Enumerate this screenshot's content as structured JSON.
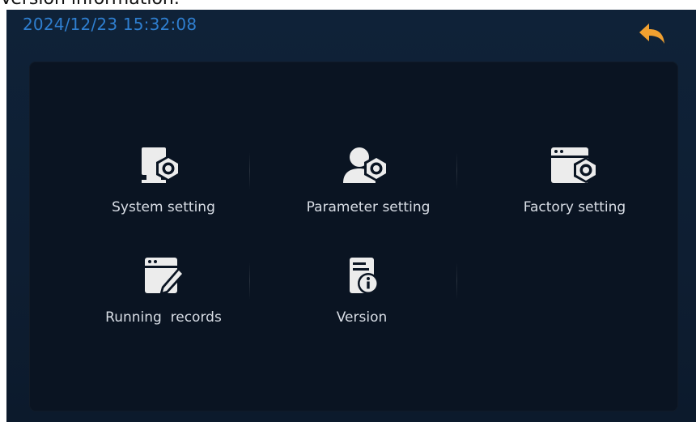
{
  "caption": "Version information.",
  "header": {
    "datetime": "2024/12/23 15:32:08",
    "back_icon": "back-arrow-icon",
    "accent_color": "#f0a030",
    "datetime_color": "#2f7fd0"
  },
  "menu": {
    "items": [
      {
        "label": "System setting",
        "icon": "system-setting-icon"
      },
      {
        "label": "Parameter setting",
        "icon": "parameter-setting-icon"
      },
      {
        "label": "Factory setting",
        "icon": "factory-setting-icon"
      },
      {
        "label": "Running  records",
        "icon": "running-records-icon"
      },
      {
        "label": "Version",
        "icon": "version-icon"
      }
    ]
  }
}
